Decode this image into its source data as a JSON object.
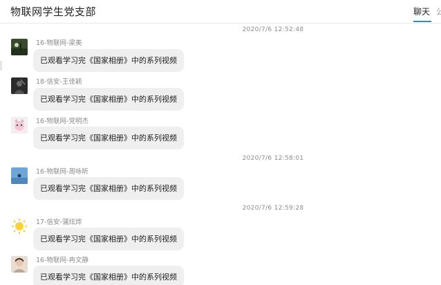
{
  "header": {
    "title": "物联网学生党支部",
    "tab_chat": "聊天",
    "tab_next_partial": "公"
  },
  "timestamps": [
    "2020/7/6 12:52:48",
    "2020/7/6 12:58:01",
    "2020/7/6 12:59:28"
  ],
  "messages": [
    {
      "sender": "16-物联网-梁美",
      "text": "已观看学习完《国家相册》中的系列视频",
      "avatar_icon": "dark-landscape-avatar"
    },
    {
      "sender": "18-信安-王佳颖",
      "text": "已观看学习完《国家相册》中的系列视频",
      "avatar_icon": "dark-figure-avatar"
    },
    {
      "sender": "16-物联网-党明杰",
      "text": "已观看学习完《国家相册》中的系列视频",
      "avatar_icon": "cartoon-avatar"
    },
    {
      "sender": "16-物联网-周咏昕",
      "text": "已观看学习完《国家相册》中的系列视频",
      "avatar_icon": "blue-sky-avatar"
    },
    {
      "sender": "17-信安-蒲炫烨",
      "text": "已观看学习完《国家相册》中的系列视频",
      "avatar_icon": "sun-avatar"
    },
    {
      "sender": "16-物联网-冉文静",
      "text": "已观看学习完《国家相册》中的系列视频",
      "avatar_icon": "portrait-avatar"
    }
  ],
  "colors": {
    "accent": "#2d86e6",
    "bubble": "#efefef",
    "meta_text": "#8a8a8a"
  }
}
